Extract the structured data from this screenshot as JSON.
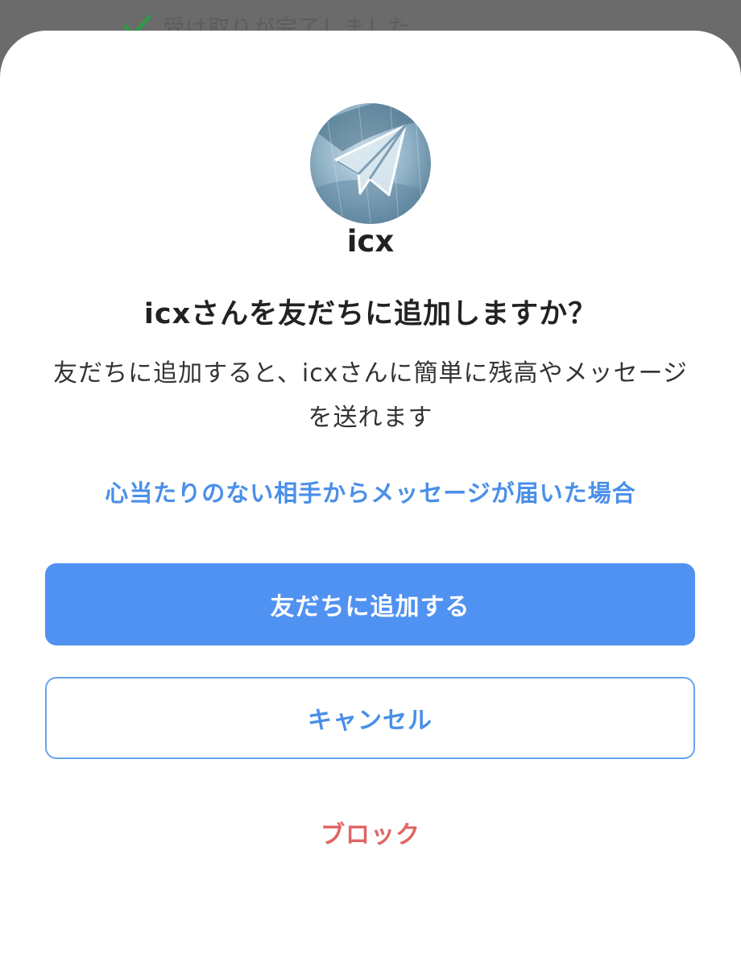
{
  "background": {
    "toast_text": "受け取りが完了しました",
    "toast_icon": "checkmark-icon",
    "toast_check_color": "#2f9a4a"
  },
  "dialog": {
    "avatar_icon": "paper-plane-avatar",
    "username": "icx",
    "question": "icxさんを友だちに追加しますか？",
    "description": "友だちに追加すると、icxさんに簡単に残高やメッセージを送れます",
    "help_link": "心当たりのない相手からメッセージが届いた場合",
    "add_friend_button": "友だちに追加する",
    "cancel_button": "キャンセル",
    "block_link": "ブロック"
  },
  "colors": {
    "primary": "#5092f1",
    "link": "#4a8fe8",
    "danger": "#e06565",
    "text": "#222222"
  }
}
